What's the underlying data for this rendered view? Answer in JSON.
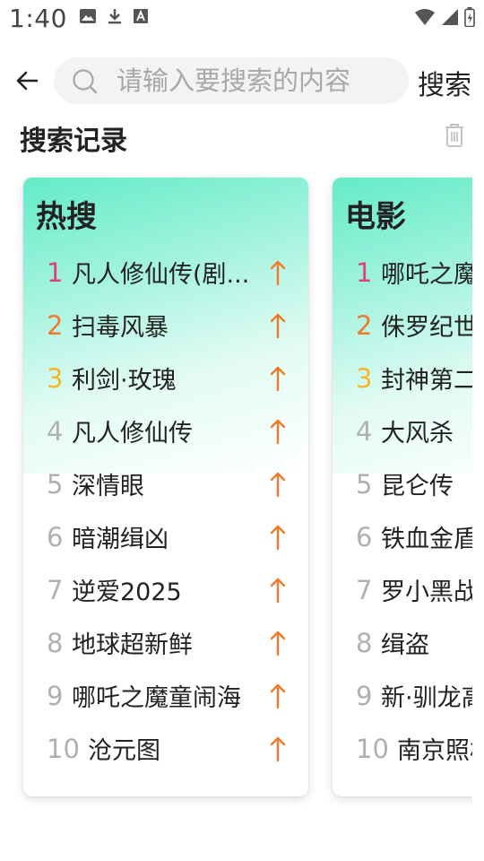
{
  "status_bar": {
    "time": "1:40",
    "left_icons": [
      "image-icon",
      "download-icon",
      "font-icon"
    ],
    "right_icons": [
      "wifi-icon",
      "signal-icon",
      "battery-icon"
    ]
  },
  "search": {
    "placeholder": "请输入要搜索的内容",
    "value": "",
    "button_label": "搜索"
  },
  "history": {
    "title": "搜索记录"
  },
  "colors": {
    "rank1": "#e0407a",
    "rank2": "#f07a2a",
    "rank3": "#f5b62c",
    "trend_up": "#f07a2a",
    "card_gradient_top": "#63ecc6"
  },
  "cards": [
    {
      "title": "热搜",
      "items": [
        {
          "rank": "1",
          "name": "凡人修仙传(剧...",
          "trend": "up"
        },
        {
          "rank": "2",
          "name": "扫毒风暴",
          "trend": "up"
        },
        {
          "rank": "3",
          "name": "利剑·玫瑰",
          "trend": "up"
        },
        {
          "rank": "4",
          "name": "凡人修仙传",
          "trend": "up"
        },
        {
          "rank": "5",
          "name": "深情眼",
          "trend": "up"
        },
        {
          "rank": "6",
          "name": "暗潮缉凶",
          "trend": "up"
        },
        {
          "rank": "7",
          "name": "逆爱2025",
          "trend": "up"
        },
        {
          "rank": "8",
          "name": "地球超新鲜",
          "trend": "up"
        },
        {
          "rank": "9",
          "name": "哪吒之魔童闹海",
          "trend": "up"
        },
        {
          "rank": "10",
          "name": "沧元图",
          "trend": "up"
        }
      ]
    },
    {
      "title": "电影",
      "items": [
        {
          "rank": "1",
          "name": "哪吒之魔童闹海",
          "trend": "up"
        },
        {
          "rank": "2",
          "name": "侏罗纪世界",
          "trend": "up"
        },
        {
          "rank": "3",
          "name": "封神第二部",
          "trend": "up"
        },
        {
          "rank": "4",
          "name": "大风杀",
          "trend": "up"
        },
        {
          "rank": "5",
          "name": "昆仑传",
          "trend": "up"
        },
        {
          "rank": "6",
          "name": "铁血金盾",
          "trend": "up"
        },
        {
          "rank": "7",
          "name": "罗小黑战记",
          "trend": "up"
        },
        {
          "rank": "8",
          "name": "缉盗",
          "trend": "up"
        },
        {
          "rank": "9",
          "name": "新·驯龙高手",
          "trend": "up"
        },
        {
          "rank": "10",
          "name": "南京照相馆",
          "trend": "up"
        }
      ]
    }
  ]
}
